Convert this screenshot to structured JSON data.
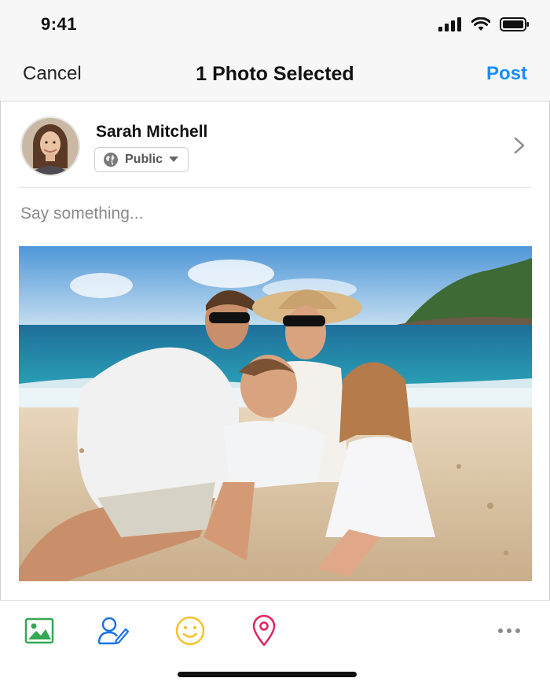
{
  "status_bar": {
    "time": "9:41"
  },
  "nav": {
    "cancel_label": "Cancel",
    "title": "1 Photo Selected",
    "post_label": "Post"
  },
  "author": {
    "name": "Sarah Mitchell",
    "privacy_label": "Public"
  },
  "composer": {
    "placeholder": "Say something..."
  },
  "colors": {
    "accent": "#1a8cff",
    "photo_tool": "#34a853",
    "tag_tool": "#1a73e8",
    "emoji_tool": "#f6c12a",
    "location_tool": "#e0245e"
  },
  "toolbar": {
    "items": [
      "photo-icon",
      "tag-people-icon",
      "emoji-icon",
      "location-pin-icon",
      "more-icon"
    ]
  }
}
